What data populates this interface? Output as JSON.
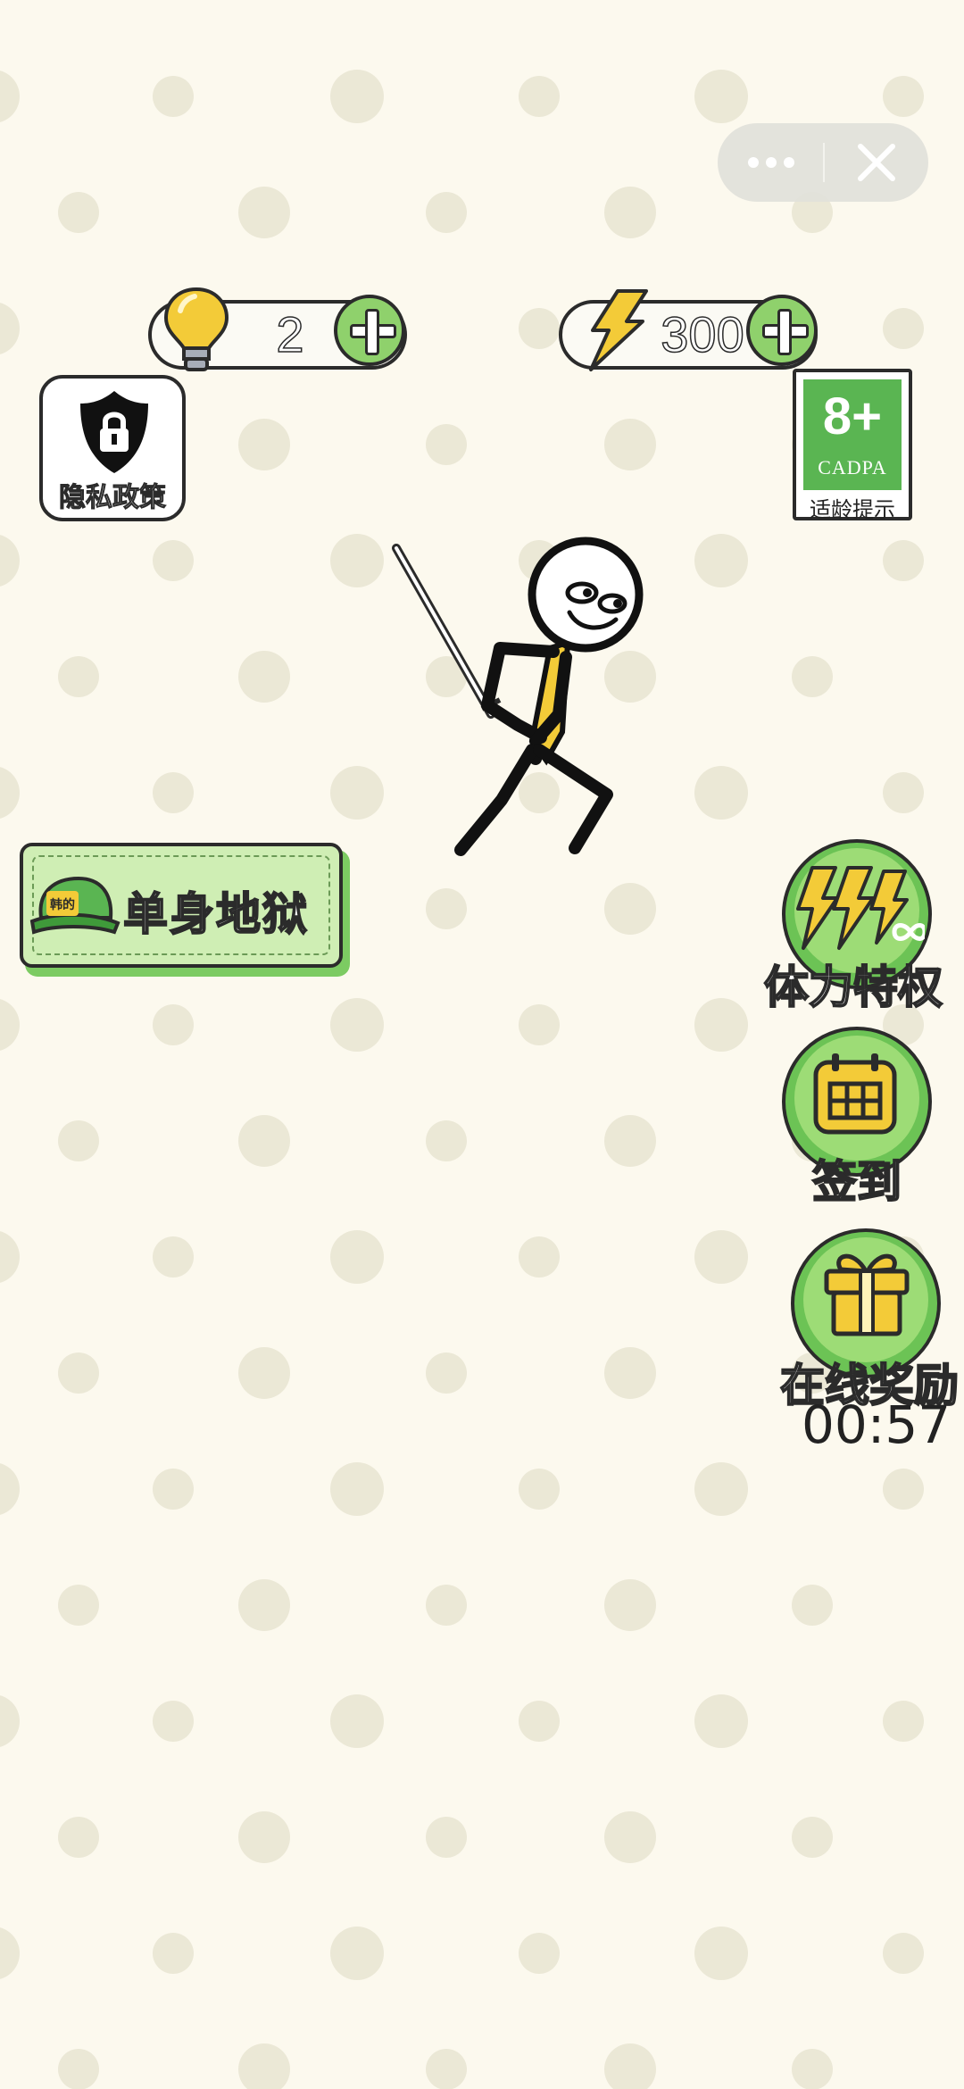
{
  "header": {
    "hints": {
      "count": "2",
      "icon": "lightbulb-icon"
    },
    "energy": {
      "count": "300",
      "icon": "lightning-icon"
    }
  },
  "capsule": {
    "more_icon": "more-dots-icon",
    "close_icon": "close-icon"
  },
  "privacy": {
    "label": "隐私政策",
    "icon": "shield-lock-icon"
  },
  "age_rating": {
    "rating": "8+",
    "org": "CADPA",
    "label": "适龄提示"
  },
  "level": {
    "title": "单身地狱",
    "badge_text": "韩的",
    "icon": "cap-icon"
  },
  "side_buttons": {
    "stamina": {
      "label": "体力特权",
      "icon": "lightning-infinity-icon"
    },
    "checkin": {
      "label": "签到",
      "icon": "calendar-icon"
    },
    "online": {
      "label": "在线奖励",
      "icon": "gift-icon",
      "timer": "00:57"
    }
  },
  "colors": {
    "background": "#fcf9ee",
    "dot": "#ebe8d6",
    "green": "#6cc355",
    "light_green": "#cfeeb4",
    "yellow": "#f3cb38",
    "outline": "#2b2b2b"
  }
}
